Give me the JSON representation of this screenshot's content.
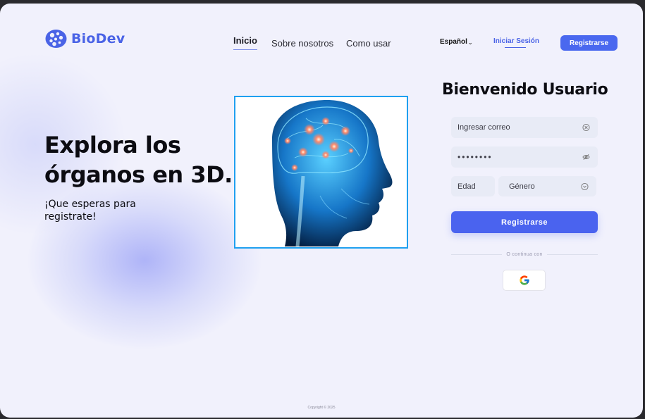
{
  "brand": {
    "name": "BioDev",
    "logo_icon": "brain-cells-logo-icon"
  },
  "nav": {
    "items": [
      "Inicio",
      "Sobre nosotros",
      "Como usar"
    ],
    "active": "Inicio"
  },
  "header": {
    "language": "Español",
    "login_label": "Iniciar Sesión",
    "register_label": "Registrarse"
  },
  "hero": {
    "title": "Explora los órganos en 3D.",
    "subtitle": "¡Que esperas para registrate!",
    "image": "glowing-brain-head-xray"
  },
  "form": {
    "title": "Bienvenido Usuario",
    "email_placeholder": "Ingresar correo",
    "password_value": "••••••••",
    "age_placeholder": "Edad",
    "gender_placeholder": "Género",
    "submit_label": "Registrarse",
    "divider_text": "O continua con",
    "google_icon": "google-icon"
  },
  "footer": {
    "copyright": "Copyright © 2025"
  },
  "colors": {
    "accent": "#4a63ef",
    "frame": "#1fa0f0",
    "background": "#f1f1fc"
  }
}
